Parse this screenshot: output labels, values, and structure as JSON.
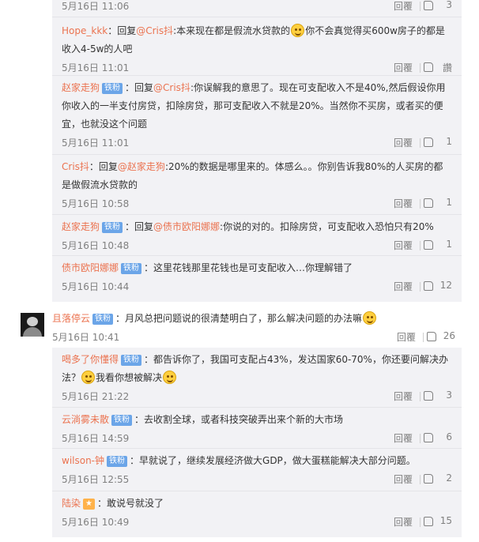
{
  "replies_top": [
    {
      "user": "",
      "badge": "",
      "mention": "",
      "text": "",
      "time": "5月16日 11:06",
      "reply_label": "回覆",
      "likes": "3"
    },
    {
      "user": "Hope_kkk",
      "badge": "",
      "mention": "@Cris抖",
      "text": ":本来现在都是假流水贷款的",
      "text_after": "你不会真觉得买600w房子的都是收入4-5w的人吧",
      "time": "5月16日 11:01",
      "reply_label": "回覆",
      "likes": "讚"
    },
    {
      "user": "赵家走狗",
      "badge": "铁粉",
      "mention": "@Cris抖",
      "text": ":你误解我的意思了。现在可支配收入不是40%,然后假设你用你收入的一半支付房贷，扣除房贷，那可支配收入不就是20%。当然你不买房，或者买的便宜，也就没这个问题",
      "time": "5月16日 11:01",
      "reply_label": "回覆",
      "likes": "1"
    },
    {
      "user": "Cris抖",
      "badge": "",
      "mention": "@赵家走狗",
      "text": ":20%的数据是哪里来的。体感么。。你别告诉我80%的人买房的都是做假流水贷款的",
      "time": "5月16日 10:58",
      "reply_label": "回覆",
      "likes": "1"
    },
    {
      "user": "赵家走狗",
      "badge": "铁粉",
      "mention": "@债市欧阳娜娜",
      "text": ":你说的对的。扣除房贷，可支配收入恐怕只有20%",
      "time": "5月16日 10:48",
      "reply_label": "回覆",
      "likes": "1"
    },
    {
      "user": "债市欧阳娜娜",
      "badge": "铁粉",
      "mention": "",
      "text": "：这里花钱那里花钱也是可支配收入…你理解错了",
      "time": "5月16日 10:44",
      "reply_label": "回覆",
      "likes": "12"
    }
  ],
  "main_comment": {
    "user": "且落停云",
    "badge": "铁粉",
    "text": "：月风总把问题说的很清楚明白了，那么解决问题的办法嘛",
    "time": "5月16日 10:41",
    "reply_label": "回覆",
    "likes": "26"
  },
  "replies_bottom": [
    {
      "user": "喝多了你懂得",
      "badge": "铁粉",
      "text": "：都告诉你了，我国可支配占43%，发达国家60-70%，你还要问解决办法？",
      "text_after": "我看你想被解决",
      "time": "5月16日 21:22",
      "reply_label": "回覆",
      "likes": "3"
    },
    {
      "user": "云淌雾未散",
      "badge": "铁粉",
      "text": "：去收割全球，或者科技突破弄出来个新的大市场",
      "time": "5月16日 14:59",
      "reply_label": "回覆",
      "likes": "6"
    },
    {
      "user": "wilson-钟",
      "badge": "铁粉",
      "text": "：早就说了，继续发展经济做大GDP，做大蛋糕能解决大部分问题。",
      "time": "5月16日 12:55",
      "reply_label": "回覆",
      "likes": "2"
    },
    {
      "user": "陆染",
      "badge": "",
      "text": "：敢说号就没了",
      "time": "5月16日 10:49",
      "reply_label": "回覆",
      "likes": "15"
    }
  ]
}
